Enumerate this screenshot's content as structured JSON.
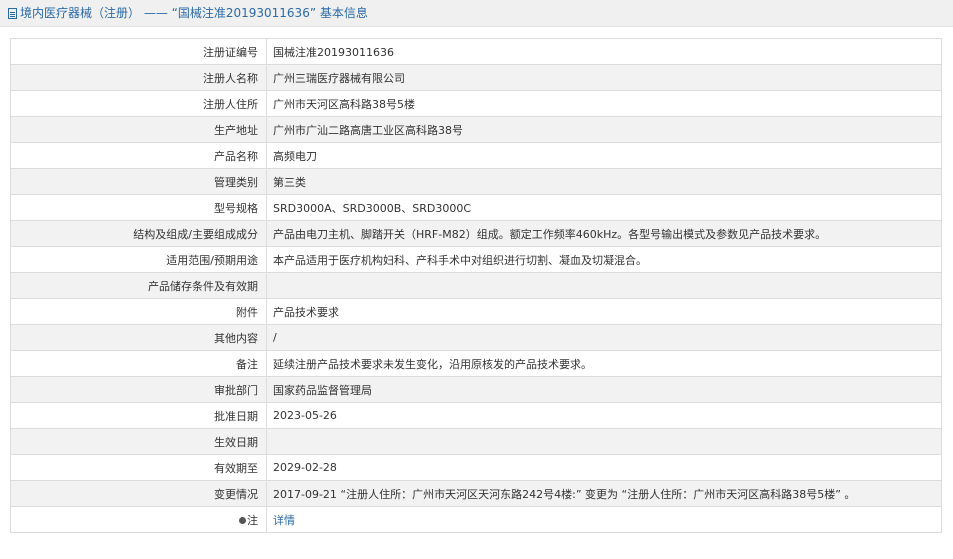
{
  "header": {
    "prefix": "境内医疗器械（注册） —— “国械注准20193011636” 基本信息"
  },
  "rows": [
    {
      "label": "注册证编号",
      "value": "国械注准20193011636"
    },
    {
      "label": "注册人名称",
      "value": "广州三瑞医疗器械有限公司"
    },
    {
      "label": "注册人住所",
      "value": "广州市天河区高科路38号5楼"
    },
    {
      "label": "生产地址",
      "value": "广州市广汕二路高唐工业区高科路38号"
    },
    {
      "label": "产品名称",
      "value": "高频电刀"
    },
    {
      "label": "管理类别",
      "value": "第三类"
    },
    {
      "label": "型号规格",
      "value": "SRD3000A、SRD3000B、SRD3000C"
    },
    {
      "label": "结构及组成/主要组成成分",
      "value": "产品由电刀主机、脚踏开关（HRF-M82）组成。额定工作频率460kHz。各型号输出模式及参数见产品技术要求。"
    },
    {
      "label": "适用范围/预期用途",
      "value": "本产品适用于医疗机构妇科、产科手术中对组织进行切割、凝血及切凝混合。"
    },
    {
      "label": "产品储存条件及有效期",
      "value": ""
    },
    {
      "label": "附件",
      "value": "产品技术要求"
    },
    {
      "label": "其他内容",
      "value": "/"
    },
    {
      "label": "备注",
      "value": "延续注册产品技术要求未发生变化，沿用原核发的产品技术要求。"
    },
    {
      "label": "审批部门",
      "value": "国家药品监督管理局"
    },
    {
      "label": "批准日期",
      "value": "2023-05-26"
    },
    {
      "label": "生效日期",
      "value": ""
    },
    {
      "label": "有效期至",
      "value": "2029-02-28"
    },
    {
      "label": "变更情况",
      "value": "2017-09-21 “注册人住所：广州市天河区天河东路242号4楼:” 变更为 “注册人住所：广州市天河区高科路38号5楼” 。"
    }
  ],
  "note_row": {
    "label": "注",
    "link": "详情"
  }
}
